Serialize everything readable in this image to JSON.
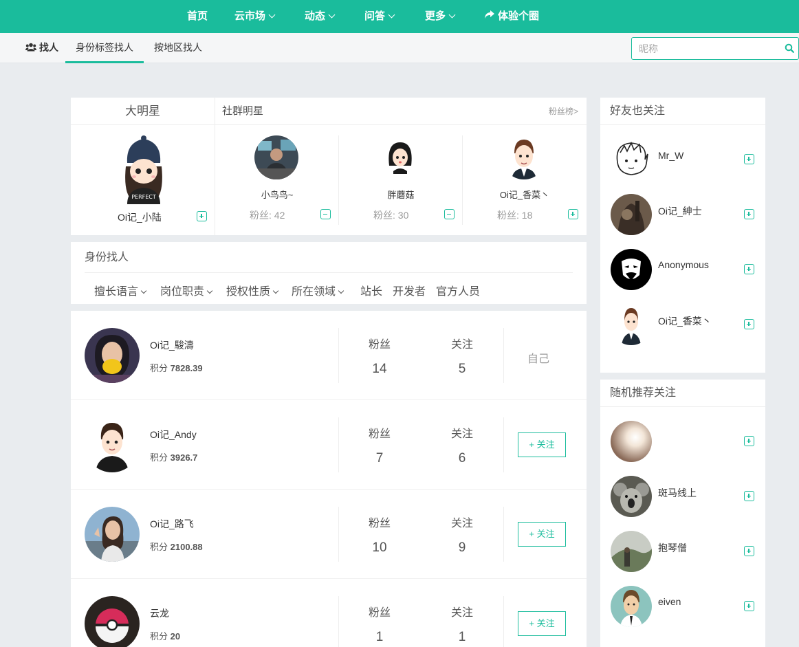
{
  "nav": {
    "items": [
      {
        "label": "首页",
        "dropdown": false
      },
      {
        "label": "云市场",
        "dropdown": true
      },
      {
        "label": "动态",
        "dropdown": true
      },
      {
        "label": "问答",
        "dropdown": true
      },
      {
        "label": "更多",
        "dropdown": true
      },
      {
        "label": "体验个圈",
        "dropdown": false
      }
    ],
    "color": "#1abc9c"
  },
  "subnav": {
    "find_label": "找人",
    "tab_identity": "身份标签找人",
    "tab_region": "按地区找人",
    "search_placeholder": "昵称"
  },
  "stars": {
    "big_star_title": "大明星",
    "big_star_name": "Oi记_小陆",
    "social_title": "社群明星",
    "fans_rank_link": "粉丝榜>",
    "social": [
      {
        "name": "小鸟鸟~",
        "fans": "粉丝: 42",
        "followed": true
      },
      {
        "name": "胖蘑菇",
        "fans": "粉丝: 30",
        "followed": true
      },
      {
        "name": "Oi记_香菜丶",
        "fans": "粉丝: 18",
        "followed": false
      }
    ]
  },
  "identity": {
    "title": "身份找人",
    "filters": [
      {
        "label": "擅长语言",
        "dropdown": true
      },
      {
        "label": "岗位职责",
        "dropdown": true
      },
      {
        "label": "授权性质",
        "dropdown": true
      },
      {
        "label": "所在领域",
        "dropdown": true
      },
      {
        "label": "站长",
        "dropdown": false
      },
      {
        "label": "开发者",
        "dropdown": false
      },
      {
        "label": "官方人员",
        "dropdown": false
      }
    ]
  },
  "list": {
    "fans_label": "粉丝",
    "follow_label": "关注",
    "score_label": "积分",
    "self_label": "自己",
    "follow_button": "+ 关注",
    "users": [
      {
        "name": "Oi记_駿濤",
        "score": "7828.39",
        "fans": "14",
        "following": "5",
        "is_self": true
      },
      {
        "name": "Oi记_Andy",
        "score": "3926.7",
        "fans": "7",
        "following": "6",
        "is_self": false
      },
      {
        "name": "Oi记_路飞",
        "score": "2100.88",
        "fans": "10",
        "following": "9",
        "is_self": false
      },
      {
        "name": "云龙",
        "score": "20",
        "fans": "1",
        "following": "1",
        "is_self": false
      }
    ]
  },
  "friends_follow": {
    "title": "好友也关注",
    "users": [
      {
        "name": "Mr_W"
      },
      {
        "name": "Oi记_紳士"
      },
      {
        "name": "Anonymous"
      },
      {
        "name": "Oi记_香菜丶"
      }
    ]
  },
  "random_recommend": {
    "title": "随机推荐关注",
    "users": [
      {
        "name": ""
      },
      {
        "name": "斑马线上"
      },
      {
        "name": "抱琴僧"
      },
      {
        "name": "eiven"
      }
    ]
  }
}
